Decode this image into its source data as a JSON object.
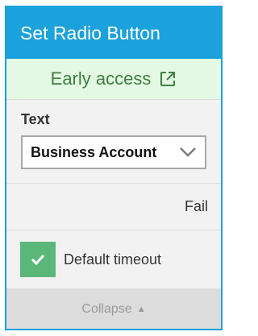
{
  "header": {
    "title": "Set Radio Button"
  },
  "early_access": {
    "label": "Early access",
    "icon": "external-link-icon"
  },
  "text_field": {
    "label": "Text",
    "selected_value": "Business Account",
    "icon": "chevron-down-icon"
  },
  "fail": {
    "label": "Fail"
  },
  "default_timeout": {
    "label": "Default timeout",
    "checked": true,
    "icon": "checkmark-icon"
  },
  "collapse": {
    "label": "Collapse",
    "icon": "caret-up-icon"
  },
  "colors": {
    "accent": "#1ba1dc",
    "early_access_bg": "#e3f9e3",
    "early_access_text": "#3f7f3f",
    "checkbox": "#5cb77a"
  }
}
